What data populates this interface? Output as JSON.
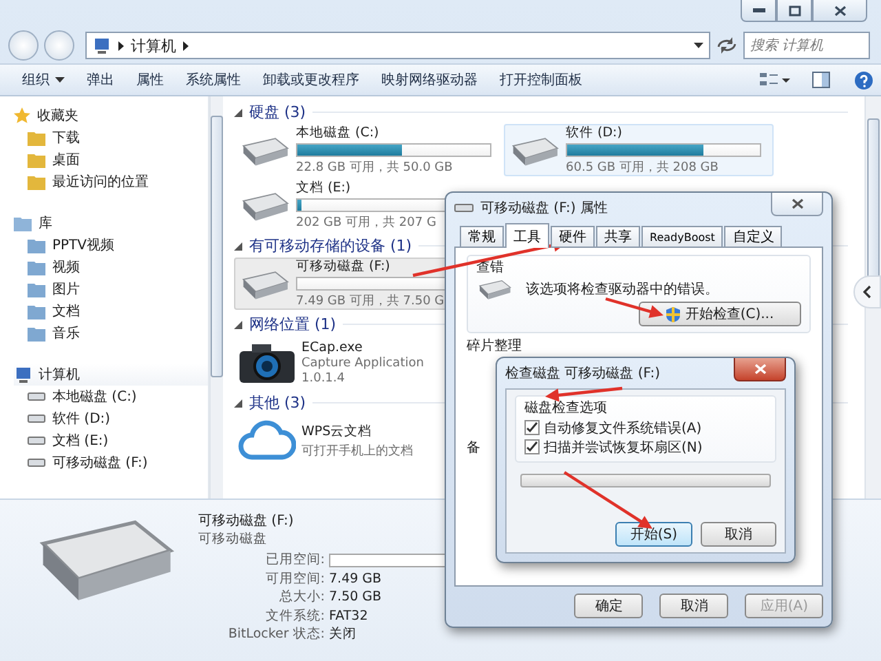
{
  "address_bar": {
    "path": [
      "计算机"
    ]
  },
  "search": {
    "placeholder": "搜索 计算机"
  },
  "toolbar": {
    "items": [
      {
        "label": "组织",
        "dropdown": true
      },
      {
        "label": "弹出",
        "dropdown": false
      },
      {
        "label": "属性",
        "dropdown": false
      },
      {
        "label": "系统属性",
        "dropdown": false
      },
      {
        "label": "卸载或更改程序",
        "dropdown": false
      },
      {
        "label": "映射网络驱动器",
        "dropdown": false
      },
      {
        "label": "打开控制面板",
        "dropdown": false
      }
    ]
  },
  "nav": {
    "sections": [
      {
        "label": "收藏夹",
        "children": [
          {
            "label": "下载"
          },
          {
            "label": "桌面"
          },
          {
            "label": "最近访问的位置"
          }
        ]
      },
      {
        "label": "库",
        "children": [
          {
            "label": "PPTV视频"
          },
          {
            "label": "视频"
          },
          {
            "label": "图片"
          },
          {
            "label": "文档"
          },
          {
            "label": "音乐"
          }
        ]
      },
      {
        "label": "计算机",
        "children": [
          {
            "label": "本地磁盘 (C:)"
          },
          {
            "label": "软件 (D:)"
          },
          {
            "label": "文档 (E:)"
          },
          {
            "label": "可移动磁盘 (F:)"
          }
        ]
      }
    ]
  },
  "content": {
    "groups": [
      {
        "title": "硬盘 (3)",
        "items": [
          {
            "kind": "drive",
            "name": "本地磁盘 (C:)",
            "level": 0.54,
            "info": "22.8 GB 可用，共 50.0 GB",
            "hovered": false,
            "selected": false
          },
          {
            "kind": "drive",
            "name": "软件 (D:)",
            "level": 0.71,
            "info": "60.5 GB 可用，共 208 GB",
            "hovered": true,
            "selected": false
          },
          {
            "kind": "drive",
            "name": "文档 (E:)",
            "level": 0.02,
            "info": "202 GB 可用，共 207 G",
            "hovered": false,
            "selected": false
          }
        ]
      },
      {
        "title": "有可移动存储的设备 (1)",
        "items": [
          {
            "kind": "drive",
            "name": "可移动磁盘 (F:)",
            "level": 0.002,
            "info": "7.49 GB 可用，共 7.50 G",
            "hovered": false,
            "selected": true
          }
        ]
      },
      {
        "title": "网络位置 (1)",
        "items": [
          {
            "kind": "app",
            "name": "ECap.exe",
            "lines": [
              "Capture Application",
              "1.0.1.4"
            ]
          }
        ]
      },
      {
        "title": "其他 (3)",
        "items": [
          {
            "kind": "app",
            "name": "WPS云文档",
            "lines": [
              "可打开手机上的文档"
            ]
          }
        ]
      }
    ]
  },
  "details": {
    "title": "可移动磁盘 (F:)",
    "subtitle": "可移动磁盘",
    "fields": [
      {
        "kind": "bar",
        "label": "已用空间:",
        "level": 0.002
      },
      {
        "kind": "text",
        "label": "可用空间:",
        "value": "7.49 GB"
      },
      {
        "kind": "text",
        "label": "总大小:",
        "value": "7.50 GB"
      },
      {
        "kind": "text",
        "label": "文件系统:",
        "value": "FAT32"
      },
      {
        "kind": "text",
        "label": "BitLocker 状态:",
        "value": "关闭"
      }
    ]
  },
  "properties_dialog": {
    "title": "可移动磁盘 (F:) 属性",
    "tabs": [
      {
        "label": "常规",
        "selected": false
      },
      {
        "label": "工具",
        "selected": true
      },
      {
        "label": "硬件",
        "selected": false
      },
      {
        "label": "共享",
        "selected": false
      },
      {
        "label": "ReadyBoost",
        "selected": false
      },
      {
        "label": "自定义",
        "selected": false
      }
    ],
    "error_check": {
      "title": "查错",
      "text": "该选项将检查驱动器中的错误。",
      "button": "开始检查(C)..."
    },
    "defrag": {
      "title": "碎片整理"
    },
    "backup": {
      "title": "备"
    },
    "buttons": [
      {
        "label": "确定",
        "disabled": false
      },
      {
        "label": "取消",
        "disabled": false
      },
      {
        "label": "应用(A)",
        "disabled": true
      }
    ]
  },
  "check_dialog": {
    "title": "检查磁盘 可移动磁盘 (F:)",
    "group": "磁盘检查选项",
    "options": [
      {
        "label": "自动修复文件系统错误(A)",
        "checked": true
      },
      {
        "label": "扫描并尝试恢复坏扇区(N)",
        "checked": true
      }
    ],
    "progress": {
      "level": 0
    },
    "buttons": [
      {
        "label": "开始(S)",
        "default": true
      },
      {
        "label": "取消",
        "default": false
      }
    ]
  }
}
